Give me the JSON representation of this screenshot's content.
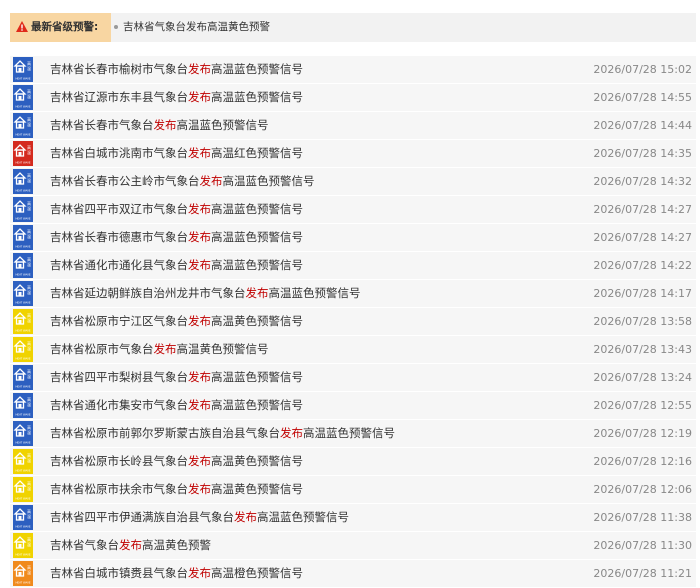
{
  "top": {
    "label": "最新省级预警:",
    "message": "吉林省气象台发布高温黄色预警"
  },
  "colors": {
    "blue": "#2c5fc0",
    "red": "#d42a1e",
    "yellow": "#f0d300",
    "orange": "#f08a1c",
    "highlight": "#c00000"
  },
  "icon_labels": {
    "name": "高温",
    "sub": "HEAT WAVE"
  },
  "alerts": [
    {
      "color": "blue",
      "pre": "吉林省长春市榆树市气象台",
      "verb": "发布",
      "post": "高温蓝色预警信号",
      "time": "2026/07/28 15:02"
    },
    {
      "color": "blue",
      "pre": "吉林省辽源市东丰县气象台",
      "verb": "发布",
      "post": "高温蓝色预警信号",
      "time": "2026/07/28 14:55"
    },
    {
      "color": "blue",
      "pre": "吉林省长春市气象台",
      "verb": "发布",
      "post": "高温蓝色预警信号",
      "time": "2026/07/28 14:44"
    },
    {
      "color": "red",
      "pre": "吉林省白城市洮南市气象台",
      "verb": "发布",
      "post": "高温红色预警信号",
      "time": "2026/07/28 14:35"
    },
    {
      "color": "blue",
      "pre": "吉林省长春市公主岭市气象台",
      "verb": "发布",
      "post": "高温蓝色预警信号",
      "time": "2026/07/28 14:32"
    },
    {
      "color": "blue",
      "pre": "吉林省四平市双辽市气象台",
      "verb": "发布",
      "post": "高温蓝色预警信号",
      "time": "2026/07/28 14:27"
    },
    {
      "color": "blue",
      "pre": "吉林省长春市德惠市气象台",
      "verb": "发布",
      "post": "高温蓝色预警信号",
      "time": "2026/07/28 14:27"
    },
    {
      "color": "blue",
      "pre": "吉林省通化市通化县气象台",
      "verb": "发布",
      "post": "高温蓝色预警信号",
      "time": "2026/07/28 14:22"
    },
    {
      "color": "blue",
      "pre": "吉林省延边朝鲜族自治州龙井市气象台",
      "verb": "发布",
      "post": "高温蓝色预警信号",
      "time": "2026/07/28 14:17"
    },
    {
      "color": "yellow",
      "pre": "吉林省松原市宁江区气象台",
      "verb": "发布",
      "post": "高温黄色预警信号",
      "time": "2026/07/28 13:58"
    },
    {
      "color": "yellow",
      "pre": "吉林省松原市气象台",
      "verb": "发布",
      "post": "高温黄色预警信号",
      "time": "2026/07/28 13:43"
    },
    {
      "color": "blue",
      "pre": "吉林省四平市梨树县气象台",
      "verb": "发布",
      "post": "高温蓝色预警信号",
      "time": "2026/07/28 13:24"
    },
    {
      "color": "blue",
      "pre": "吉林省通化市集安市气象台",
      "verb": "发布",
      "post": "高温蓝色预警信号",
      "time": "2026/07/28 12:55"
    },
    {
      "color": "blue",
      "pre": "吉林省松原市前郭尔罗斯蒙古族自治县气象台",
      "verb": "发布",
      "post": "高温蓝色预警信号",
      "time": "2026/07/28 12:19"
    },
    {
      "color": "yellow",
      "pre": "吉林省松原市长岭县气象台",
      "verb": "发布",
      "post": "高温黄色预警信号",
      "time": "2026/07/28 12:16"
    },
    {
      "color": "yellow",
      "pre": "吉林省松原市扶余市气象台",
      "verb": "发布",
      "post": "高温黄色预警信号",
      "time": "2026/07/28 12:06"
    },
    {
      "color": "blue",
      "pre": "吉林省四平市伊通满族自治县气象台",
      "verb": "发布",
      "post": "高温蓝色预警信号",
      "time": "2026/07/28 11:38"
    },
    {
      "color": "yellow",
      "pre": "吉林省气象台",
      "verb": "发布",
      "post": "高温黄色预警",
      "time": "2026/07/28 11:30"
    },
    {
      "color": "orange",
      "pre": "吉林省白城市镇赉县气象台",
      "verb": "发布",
      "post": "高温橙色预警信号",
      "time": "2026/07/28 11:21"
    }
  ]
}
